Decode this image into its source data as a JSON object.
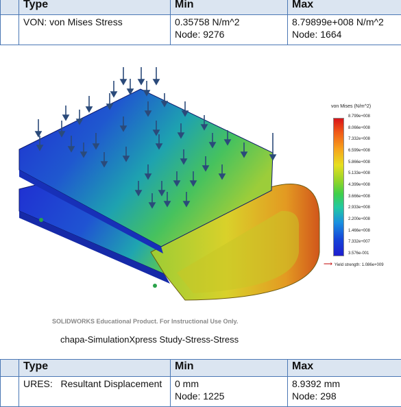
{
  "stress_table": {
    "headers": [
      "Type",
      "Min",
      "Max"
    ],
    "row": {
      "type": "VON: von Mises Stress",
      "min_value": "0.35758 N/m^2",
      "min_node": "Node: 9276",
      "max_value": "8.79899e+008 N/m^2",
      "max_node": "Node: 1664"
    }
  },
  "plot": {
    "legend_title": "von Mises (N/m^2)",
    "legend_ticks": [
      "8.799e+008",
      "8.066e+008",
      "7.332e+008",
      "6.599e+008",
      "5.866e+008",
      "5.133e+008",
      "4.399e+008",
      "3.666e+008",
      "2.933e+008",
      "2.200e+008",
      "1.466e+008",
      "7.332e+007",
      "3.576e-001"
    ],
    "yield_label": "Yield strength: 1.086e+009",
    "watermark": "SOLIDWORKS Educational Product. For Instructional Use Only.",
    "caption": "chapa-SimulationXpress Study-Stress-Stress"
  },
  "displacement_table": {
    "headers": [
      "Type",
      "Min",
      "Max"
    ],
    "row": {
      "type": "URES:   Resultant Displacement",
      "min_value": "0 mm",
      "min_node": "Node: 1225",
      "max_value": "8.9392 mm",
      "max_node": "Node: 298"
    }
  },
  "colors": {
    "table_border": "#4a77b4",
    "header_bg": "#dbe5f1",
    "yield_arrow": "#c00000"
  }
}
